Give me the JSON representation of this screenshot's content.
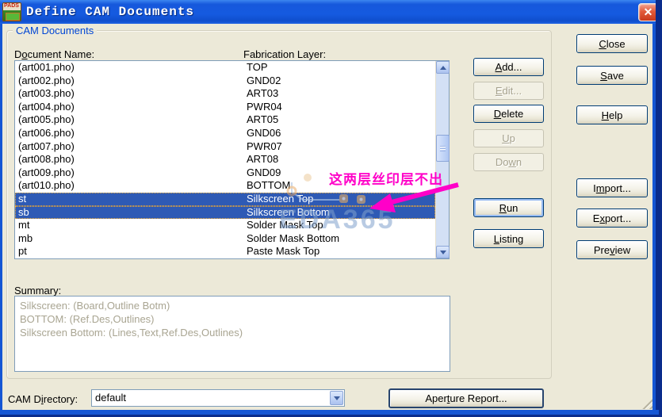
{
  "window": {
    "title": "Define CAM Documents"
  },
  "group": {
    "title": "CAM Documents"
  },
  "labels": {
    "document_name": {
      "label": "Document Name:",
      "mnemonic": "o"
    },
    "fabrication_layer": {
      "label": "Fabrication Layer:",
      "mnemonic": ""
    },
    "summary": "Summary:",
    "cam_directory": {
      "label": "CAM Directory:",
      "mnemonic": "i"
    }
  },
  "cam_list": {
    "rows": [
      {
        "name": "(art001.pho)",
        "layer": "TOP",
        "selected": false
      },
      {
        "name": "(art002.pho)",
        "layer": "GND02",
        "selected": false
      },
      {
        "name": "(art003.pho)",
        "layer": "ART03",
        "selected": false
      },
      {
        "name": "(art004.pho)",
        "layer": "PWR04",
        "selected": false
      },
      {
        "name": "(art005.pho)",
        "layer": "ART05",
        "selected": false
      },
      {
        "name": "(art006.pho)",
        "layer": "GND06",
        "selected": false
      },
      {
        "name": "(art007.pho)",
        "layer": "PWR07",
        "selected": false
      },
      {
        "name": "(art008.pho)",
        "layer": "ART08",
        "selected": false
      },
      {
        "name": "(art009.pho)",
        "layer": "GND09",
        "selected": false
      },
      {
        "name": "(art010.pho)",
        "layer": "BOTTOM",
        "selected": false
      },
      {
        "name": "st",
        "layer": "Silkscreen Top",
        "selected": true
      },
      {
        "name": "sb",
        "layer": "Silkscreen Bottom",
        "selected": true
      },
      {
        "name": "mt",
        "layer": "Solder Mask Top",
        "selected": false
      },
      {
        "name": "mb",
        "layer": "Solder Mask Bottom",
        "selected": false
      },
      {
        "name": "pt",
        "layer": "Paste Mask Top",
        "selected": false
      }
    ]
  },
  "summary_lines": [
    "Silkscreen: (Board,Outline Botm)",
    "BOTTOM: (Ref.Des,Outlines)",
    "Silkscreen Bottom: (Lines,Text,Ref.Des,Outlines)"
  ],
  "buttons": {
    "add": {
      "label": "Add...",
      "mnemonic": "A",
      "enabled": true
    },
    "edit": {
      "label": "Edit...",
      "mnemonic": "E",
      "enabled": false
    },
    "delete": {
      "label": "Delete",
      "mnemonic": "D",
      "enabled": true
    },
    "up": {
      "label": "Up",
      "mnemonic": "U",
      "enabled": false
    },
    "down": {
      "label": "Down",
      "mnemonic": "w",
      "enabled": false
    },
    "run": {
      "label": "Run",
      "mnemonic": "R",
      "enabled": true
    },
    "listing": {
      "label": "Listing",
      "mnemonic": "L",
      "enabled": true
    },
    "close": {
      "label": "Close",
      "mnemonic": "C",
      "enabled": true
    },
    "save": {
      "label": "Save",
      "mnemonic": "S",
      "enabled": true
    },
    "help": {
      "label": "Help",
      "mnemonic": "H",
      "enabled": true
    },
    "import": {
      "label": "Import...",
      "mnemonic": "m",
      "enabled": true
    },
    "export": {
      "label": "Export...",
      "mnemonic": "x",
      "enabled": true
    },
    "preview": {
      "label": "Preview",
      "mnemonic": "v",
      "enabled": true
    },
    "aperture_report": {
      "label": "Aperture Report...",
      "mnemonic": "t",
      "enabled": true
    }
  },
  "cam_directory": {
    "value": "default"
  },
  "annotation": {
    "text": "这两层丝印层不出",
    "color": "#FF00C8"
  },
  "watermark": "EDA365",
  "colors": {
    "selection_blue": "#2E5AB5",
    "titlebar_blue": "#155AE0",
    "dialog_face": "#ECE9D8",
    "group_label_blue": "#0046D5",
    "annotation_magenta": "#FF00C8",
    "disabled_text": "#A6A28E"
  }
}
